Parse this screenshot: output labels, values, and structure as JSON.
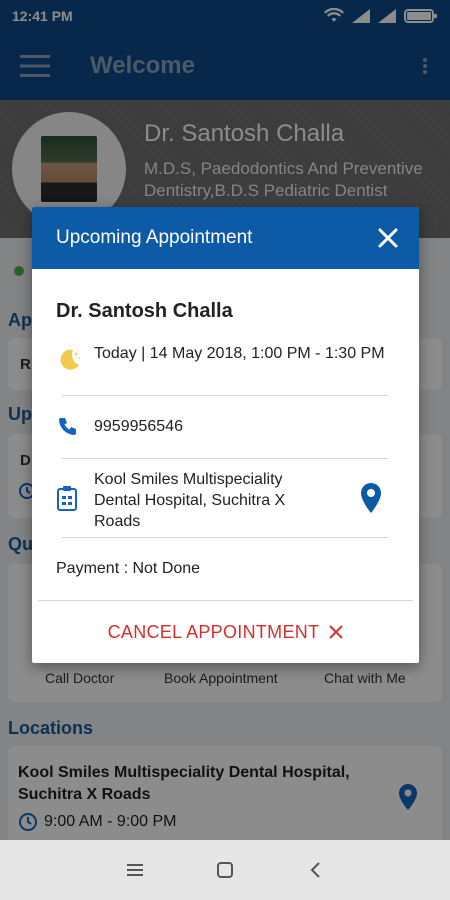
{
  "status_bar": {
    "time": "12:41 PM"
  },
  "app_bar": {
    "title": "Welcome"
  },
  "profile": {
    "name": "Dr. Santosh Challa",
    "qualification": "M.D.S, Paedodontics And Preventive Dentistry,B.D.S Pediatric Dentist"
  },
  "background": {
    "sections": [
      {
        "label": "Ap"
      },
      {
        "label": "Up"
      },
      {
        "label": "Qu"
      },
      {
        "label": "Locations"
      }
    ],
    "row_text_1": "R",
    "row_text_2": "D",
    "quick_actions": [
      "Call Doctor",
      "Book Appointment",
      "Chat with Me"
    ],
    "location": {
      "name": "Kool Smiles Multispeciality Dental Hospital, Suchitra X Roads",
      "hours": "9:00 AM - 9:00 PM"
    }
  },
  "modal": {
    "title": "Upcoming Appointment",
    "doctor": "Dr. Santosh Challa",
    "datetime": "Today | 14 May 2018, 1:00 PM - 1:30 PM",
    "phone": "9959956546",
    "clinic": "Kool Smiles Multispeciality Dental Hospital, Suchitra X Roads",
    "payment": "Payment : Not Done",
    "cancel_label": "CANCEL APPOINTMENT"
  },
  "colors": {
    "primary": "#0d4a87",
    "modal_header": "#0d5aa7",
    "cancel": "#d32f2f",
    "accent_icon": "#1565c0",
    "moon": "#f2c94c"
  },
  "icons": [
    "menu-icon",
    "more-vert-icon",
    "close-icon",
    "moon-icon",
    "phone-icon",
    "clinic-icon",
    "location-pin-icon",
    "cancel-x-icon",
    "clock-icon",
    "nav-recents-icon",
    "nav-home-icon",
    "nav-back-icon"
  ]
}
